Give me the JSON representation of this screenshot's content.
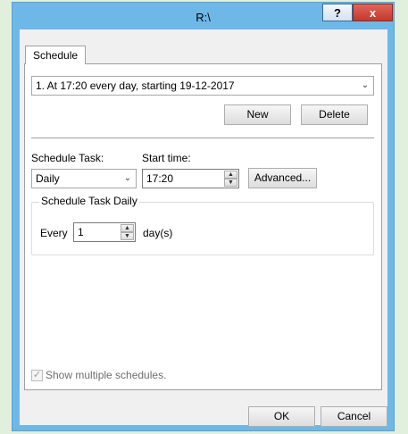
{
  "window": {
    "title": "R:\\",
    "help_label": "?",
    "close_label": "x"
  },
  "tabs": [
    {
      "label": "Schedule"
    }
  ],
  "schedule": {
    "selected": "1. At 17:20 every day, starting 19-12-2017",
    "new_label": "New",
    "delete_label": "Delete"
  },
  "task": {
    "schedule_task_label": "Schedule Task:",
    "schedule_task_value": "Daily",
    "start_time_label": "Start time:",
    "start_time_value": "17:20",
    "advanced_label": "Advanced..."
  },
  "daily": {
    "group_label": "Schedule Task Daily",
    "every_label": "Every",
    "every_value": "1",
    "unit_label": "day(s)"
  },
  "options": {
    "show_multiple_label": "Show multiple schedules.",
    "show_multiple_checked": true
  },
  "footer": {
    "ok_label": "OK",
    "cancel_label": "Cancel"
  },
  "colors": {
    "desktop": "#e1f0dc",
    "frame": "#6eb8e8",
    "close_button": "#c4382b"
  }
}
